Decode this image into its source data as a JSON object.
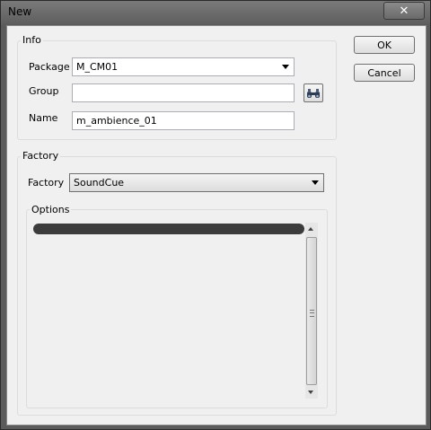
{
  "window": {
    "title": "New",
    "close_glyph": "✕"
  },
  "info": {
    "legend": "Info",
    "package_label": "Package",
    "package_value": "M_CM01",
    "group_label": "Group",
    "group_value": "",
    "name_label": "Name",
    "name_value": "m_ambience_01"
  },
  "factory_group": {
    "legend": "Factory",
    "factory_label": "Factory",
    "factory_value": "SoundCue",
    "options_legend": "Options"
  },
  "buttons": {
    "ok": "OK",
    "cancel": "Cancel"
  }
}
